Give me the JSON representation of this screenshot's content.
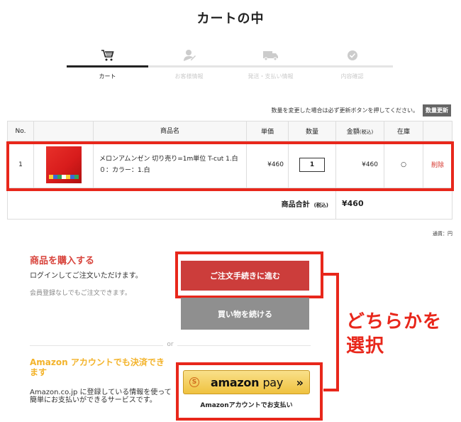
{
  "page": {
    "title": "カートの中"
  },
  "steps": [
    {
      "label": "カート",
      "icon": "cart-icon",
      "active": true
    },
    {
      "label": "お客様情報",
      "icon": "user-icon",
      "active": false
    },
    {
      "label": "発送・支払い情報",
      "icon": "truck-icon",
      "active": false
    },
    {
      "label": "内容確認",
      "icon": "check-icon",
      "active": false
    }
  ],
  "notice": {
    "text": "数量を変更した場合は必ず更新ボタンを押してください。",
    "update_button": "数量更新"
  },
  "table": {
    "headers": {
      "no": "No.",
      "name": "商品名",
      "unit_price": "単価",
      "qty": "数量",
      "amount": "金額",
      "amount_note": "(税込)",
      "stock": "在庫"
    },
    "rows": [
      {
        "no": "1",
        "name": "メロンアムンゼン 切り売り=1m単位 T-cut 1.白",
        "option": "０：カラー：1.白",
        "price": "¥460",
        "qty": "1",
        "amount": "¥460",
        "stock": "○",
        "delete": "削除"
      }
    ],
    "total": {
      "label": "商品合計",
      "note": "(税込)",
      "value": "¥460"
    }
  },
  "currency_note": "通貨：円",
  "purchase": {
    "title": "商品を購入する",
    "desc": "ログインしてご注文いただけます。",
    "sub": "会員登録なしでもご注文できます。",
    "order_button": "ご注文手続きに進む",
    "continue_button": "買い物を続ける"
  },
  "or_text": "or",
  "amazon": {
    "title": "Amazon アカウントでも決済できます",
    "desc": "Amazon.co.jp に登録している情報を使って簡単にお支払いができるサービスです。",
    "logo_amazon": "amazon",
    "logo_pay": "pay",
    "logo_s": "S",
    "arrows": "»",
    "caption": "Amazonアカウントでお支払い"
  },
  "callout": {
    "line1": "どちらかを",
    "line2": "選択"
  },
  "colors": {
    "accent": "#e8271b",
    "order_button": "#cc3d3b",
    "continue_button": "#8f8f8f",
    "amazon_title": "#f3b32a",
    "amazon_button": "#efc23f"
  }
}
